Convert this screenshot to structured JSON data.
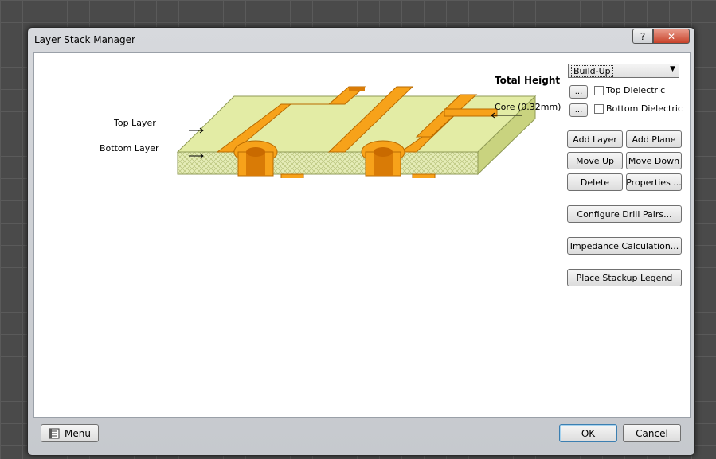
{
  "window": {
    "title": "Layer Stack Manager",
    "help_label": "?",
    "close_label": "✕"
  },
  "stack": {
    "top_layer_label": "Top Layer",
    "bottom_layer_label": "Bottom Layer",
    "total_height_label": "Total Height",
    "core_label": "Core (0.32mm)"
  },
  "controls": {
    "preset_value": "Build-Up",
    "top_dielectric": {
      "button": "...",
      "label": "Top Dielectric",
      "checked": false
    },
    "bottom_dielectric": {
      "button": "...",
      "label": "Bottom Dielectric",
      "checked": false
    },
    "add_layer": "Add Layer",
    "add_plane": "Add Plane",
    "move_up": "Move Up",
    "move_down": "Move Down",
    "delete": "Delete",
    "properties": "Properties ...",
    "configure_drill_pairs": "Configure Drill Pairs...",
    "impedance_calculation": "Impedance Calculation...",
    "place_stackup_legend": "Place Stackup Legend"
  },
  "footer": {
    "menu": "Menu",
    "ok": "OK",
    "cancel": "Cancel"
  },
  "colors": {
    "board": "#e3eca5",
    "copper": "#f7a21a",
    "copper_dark": "#d97b06"
  }
}
